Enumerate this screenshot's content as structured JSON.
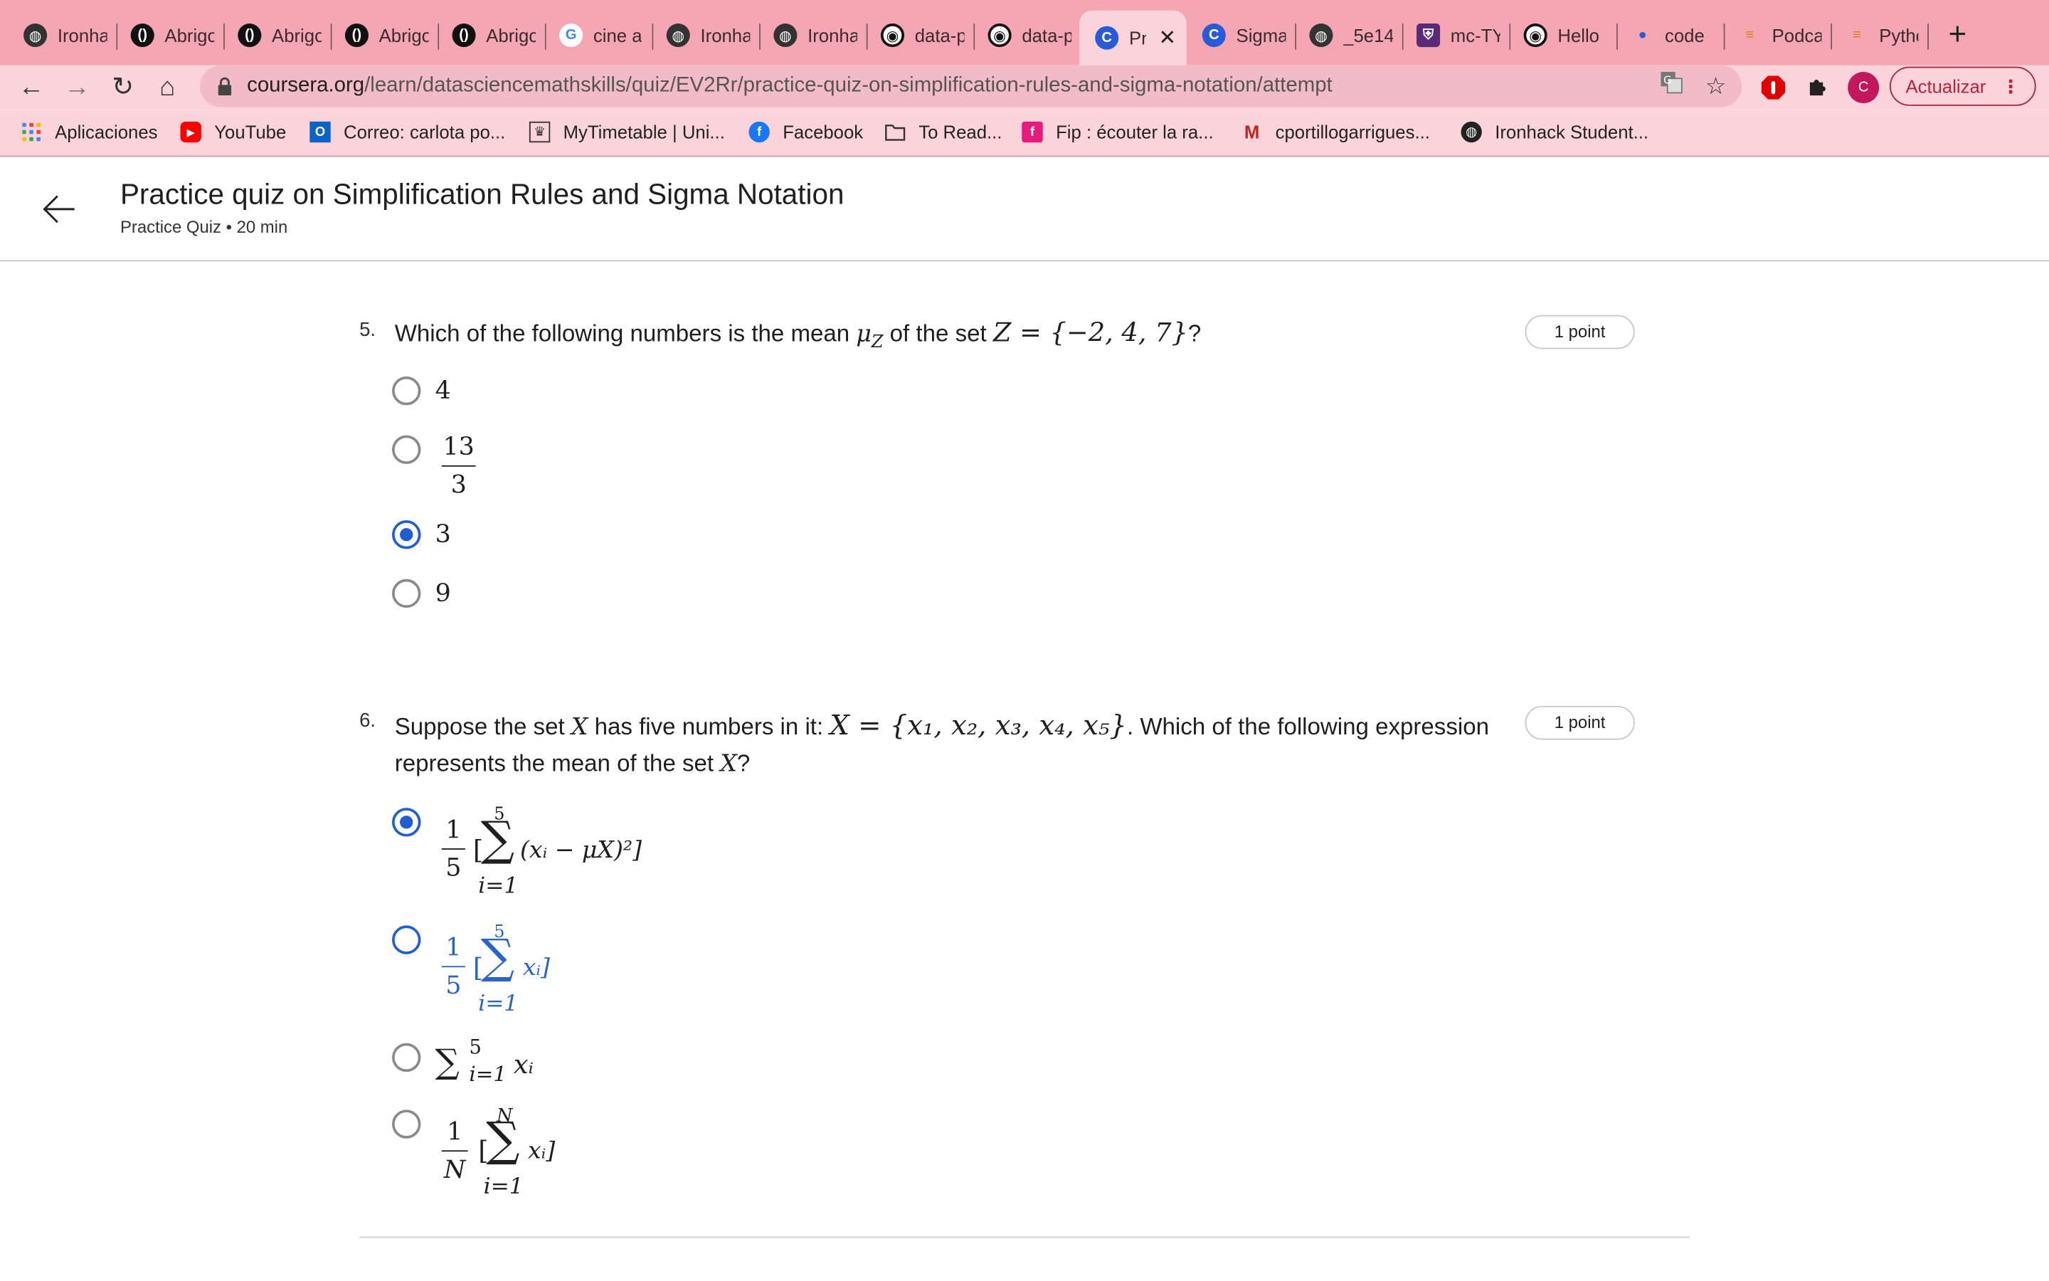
{
  "browser": {
    "tabs": [
      {
        "label": "Ironha",
        "icon": "globe-icon"
      },
      {
        "label": "Abrigo",
        "icon": "circle-logo-icon"
      },
      {
        "label": "Abrigo",
        "icon": "circle-logo-icon"
      },
      {
        "label": "Abrigo",
        "icon": "circle-logo-icon"
      },
      {
        "label": "Abrigo",
        "icon": "circle-logo-icon"
      },
      {
        "label": "cine a",
        "icon": "google-icon"
      },
      {
        "label": "Ironha",
        "icon": "globe-icon"
      },
      {
        "label": "Ironha",
        "icon": "globe-icon"
      },
      {
        "label": "data-p",
        "icon": "github-icon"
      },
      {
        "label": "data-p",
        "icon": "github-icon"
      },
      {
        "label": "Pra",
        "icon": "coursera-icon",
        "active": true
      },
      {
        "label": "Sigma",
        "icon": "coursera-icon"
      },
      {
        "label": "_5e14",
        "icon": "globe-icon"
      },
      {
        "label": "mc-TY",
        "icon": "shield-icon"
      },
      {
        "label": "Hello",
        "icon": "github-icon"
      },
      {
        "label": "code",
        "icon": "pin-icon"
      },
      {
        "label": "Podca",
        "icon": "stack-icon"
      },
      {
        "label": "Pytho",
        "icon": "stack-icon"
      }
    ],
    "new_tab": "+",
    "url_host": "coursera.org",
    "url_path": "/learn/datasciencemathskills/quiz/EV2Rr/practice-quiz-on-simplification-rules-and-sigma-notation/attempt",
    "profile_initial": "C",
    "update_label": "Actualizar",
    "bookmarks": [
      {
        "label": "Aplicaciones",
        "icon": "apps-grid-icon"
      },
      {
        "label": "YouTube",
        "icon": "youtube-icon"
      },
      {
        "label": "Correo: carlota po...",
        "icon": "outlook-icon"
      },
      {
        "label": "MyTimetable | Uni...",
        "icon": "crest-icon"
      },
      {
        "label": "Facebook",
        "icon": "facebook-icon"
      },
      {
        "label": "To Read...",
        "icon": "folder-icon"
      },
      {
        "label": "Fip : écouter la ra...",
        "icon": "fip-icon"
      },
      {
        "label": "cportillogarrigues...",
        "icon": "gmail-icon"
      },
      {
        "label": "Ironhack Student...",
        "icon": "globe-icon"
      }
    ],
    "colors": {
      "tabstrip": "#f4a7b3",
      "toolbar": "#fbd3da",
      "accent": "#1f5fd1"
    }
  },
  "quiz": {
    "title": "Practice quiz on Simplification Rules and Sigma Notation",
    "subtitle": "Practice Quiz • 20 min"
  },
  "q5": {
    "number": "5.",
    "text_a": "Which of the following numbers is the mean ",
    "mu": "μ",
    "mu_sub": "Z",
    "text_b": " of the set ",
    "set": "Z = {−2, 4, 7}",
    "text_c": "?",
    "points": "1 point",
    "options": [
      {
        "label": "4",
        "selected": false
      },
      {
        "num": "13",
        "den": "3",
        "selected": false
      },
      {
        "label": "3",
        "selected": true
      },
      {
        "label": "9",
        "selected": false
      }
    ]
  },
  "q6": {
    "number": "6.",
    "text_a": "Suppose the set ",
    "var_x": "X",
    "text_b": " has five numbers in it: ",
    "set": "X = {x₁, x₂, x₃, x₄, x₅}",
    "text_c": ". Which of the following expression",
    "text_d": "represents the mean of the set ",
    "text_e": "?",
    "points": "1 point",
    "opt1": {
      "num": "1",
      "den": "5",
      "upper": "5",
      "lower": "i=1",
      "body": "(xᵢ − μX)²]",
      "open": "[",
      "selected": true
    },
    "opt2": {
      "num": "1",
      "den": "5",
      "upper": "5",
      "lower": "i=1",
      "body": "xᵢ]",
      "open": "[",
      "selected": false
    },
    "opt3": {
      "expr": "∑",
      "upper": "5",
      "lower": "i=1",
      "body": "xᵢ",
      "selected": false
    },
    "opt4": {
      "num": "1",
      "den": "N",
      "upper": "N",
      "lower": "i=1",
      "body": "xᵢ]",
      "open": "[",
      "selected": false
    }
  }
}
